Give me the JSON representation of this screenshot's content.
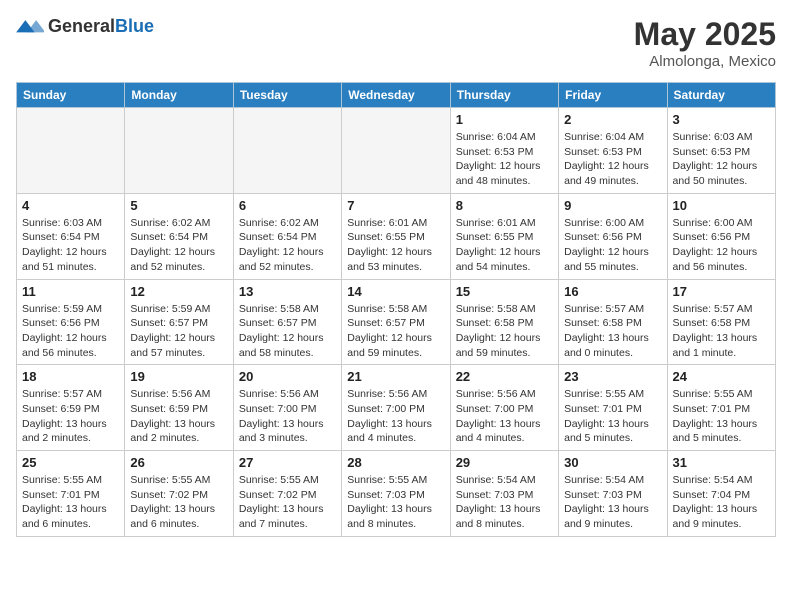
{
  "header": {
    "logo_general": "General",
    "logo_blue": "Blue",
    "title": "May 2025",
    "location": "Almolonga, Mexico"
  },
  "days_of_week": [
    "Sunday",
    "Monday",
    "Tuesday",
    "Wednesday",
    "Thursday",
    "Friday",
    "Saturday"
  ],
  "weeks": [
    [
      {
        "day": "",
        "info": ""
      },
      {
        "day": "",
        "info": ""
      },
      {
        "day": "",
        "info": ""
      },
      {
        "day": "",
        "info": ""
      },
      {
        "day": "1",
        "info": "Sunrise: 6:04 AM\nSunset: 6:53 PM\nDaylight: 12 hours\nand 48 minutes."
      },
      {
        "day": "2",
        "info": "Sunrise: 6:04 AM\nSunset: 6:53 PM\nDaylight: 12 hours\nand 49 minutes."
      },
      {
        "day": "3",
        "info": "Sunrise: 6:03 AM\nSunset: 6:53 PM\nDaylight: 12 hours\nand 50 minutes."
      }
    ],
    [
      {
        "day": "4",
        "info": "Sunrise: 6:03 AM\nSunset: 6:54 PM\nDaylight: 12 hours\nand 51 minutes."
      },
      {
        "day": "5",
        "info": "Sunrise: 6:02 AM\nSunset: 6:54 PM\nDaylight: 12 hours\nand 52 minutes."
      },
      {
        "day": "6",
        "info": "Sunrise: 6:02 AM\nSunset: 6:54 PM\nDaylight: 12 hours\nand 52 minutes."
      },
      {
        "day": "7",
        "info": "Sunrise: 6:01 AM\nSunset: 6:55 PM\nDaylight: 12 hours\nand 53 minutes."
      },
      {
        "day": "8",
        "info": "Sunrise: 6:01 AM\nSunset: 6:55 PM\nDaylight: 12 hours\nand 54 minutes."
      },
      {
        "day": "9",
        "info": "Sunrise: 6:00 AM\nSunset: 6:56 PM\nDaylight: 12 hours\nand 55 minutes."
      },
      {
        "day": "10",
        "info": "Sunrise: 6:00 AM\nSunset: 6:56 PM\nDaylight: 12 hours\nand 56 minutes."
      }
    ],
    [
      {
        "day": "11",
        "info": "Sunrise: 5:59 AM\nSunset: 6:56 PM\nDaylight: 12 hours\nand 56 minutes."
      },
      {
        "day": "12",
        "info": "Sunrise: 5:59 AM\nSunset: 6:57 PM\nDaylight: 12 hours\nand 57 minutes."
      },
      {
        "day": "13",
        "info": "Sunrise: 5:58 AM\nSunset: 6:57 PM\nDaylight: 12 hours\nand 58 minutes."
      },
      {
        "day": "14",
        "info": "Sunrise: 5:58 AM\nSunset: 6:57 PM\nDaylight: 12 hours\nand 59 minutes."
      },
      {
        "day": "15",
        "info": "Sunrise: 5:58 AM\nSunset: 6:58 PM\nDaylight: 12 hours\nand 59 minutes."
      },
      {
        "day": "16",
        "info": "Sunrise: 5:57 AM\nSunset: 6:58 PM\nDaylight: 13 hours\nand 0 minutes."
      },
      {
        "day": "17",
        "info": "Sunrise: 5:57 AM\nSunset: 6:58 PM\nDaylight: 13 hours\nand 1 minute."
      }
    ],
    [
      {
        "day": "18",
        "info": "Sunrise: 5:57 AM\nSunset: 6:59 PM\nDaylight: 13 hours\nand 2 minutes."
      },
      {
        "day": "19",
        "info": "Sunrise: 5:56 AM\nSunset: 6:59 PM\nDaylight: 13 hours\nand 2 minutes."
      },
      {
        "day": "20",
        "info": "Sunrise: 5:56 AM\nSunset: 7:00 PM\nDaylight: 13 hours\nand 3 minutes."
      },
      {
        "day": "21",
        "info": "Sunrise: 5:56 AM\nSunset: 7:00 PM\nDaylight: 13 hours\nand 4 minutes."
      },
      {
        "day": "22",
        "info": "Sunrise: 5:56 AM\nSunset: 7:00 PM\nDaylight: 13 hours\nand 4 minutes."
      },
      {
        "day": "23",
        "info": "Sunrise: 5:55 AM\nSunset: 7:01 PM\nDaylight: 13 hours\nand 5 minutes."
      },
      {
        "day": "24",
        "info": "Sunrise: 5:55 AM\nSunset: 7:01 PM\nDaylight: 13 hours\nand 5 minutes."
      }
    ],
    [
      {
        "day": "25",
        "info": "Sunrise: 5:55 AM\nSunset: 7:01 PM\nDaylight: 13 hours\nand 6 minutes."
      },
      {
        "day": "26",
        "info": "Sunrise: 5:55 AM\nSunset: 7:02 PM\nDaylight: 13 hours\nand 6 minutes."
      },
      {
        "day": "27",
        "info": "Sunrise: 5:55 AM\nSunset: 7:02 PM\nDaylight: 13 hours\nand 7 minutes."
      },
      {
        "day": "28",
        "info": "Sunrise: 5:55 AM\nSunset: 7:03 PM\nDaylight: 13 hours\nand 8 minutes."
      },
      {
        "day": "29",
        "info": "Sunrise: 5:54 AM\nSunset: 7:03 PM\nDaylight: 13 hours\nand 8 minutes."
      },
      {
        "day": "30",
        "info": "Sunrise: 5:54 AM\nSunset: 7:03 PM\nDaylight: 13 hours\nand 9 minutes."
      },
      {
        "day": "31",
        "info": "Sunrise: 5:54 AM\nSunset: 7:04 PM\nDaylight: 13 hours\nand 9 minutes."
      }
    ]
  ]
}
